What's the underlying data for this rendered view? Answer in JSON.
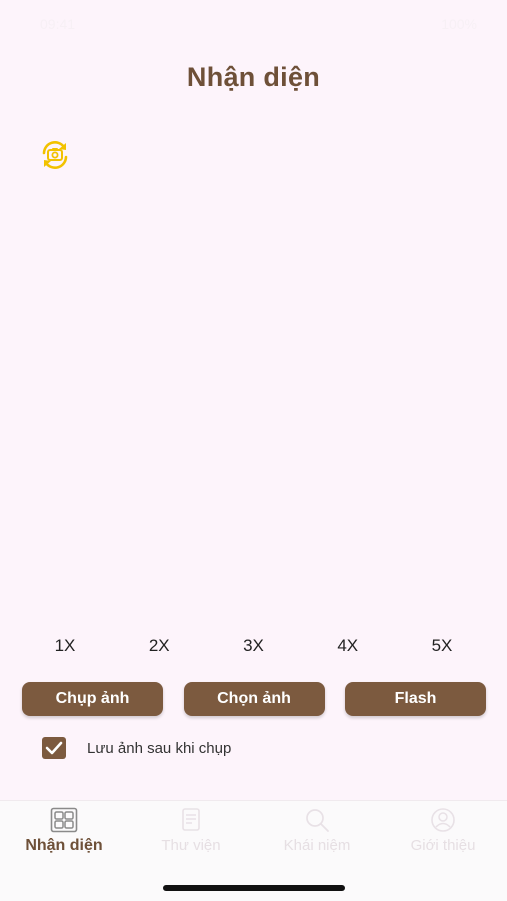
{
  "status_bar": {
    "time": "09:41",
    "battery": "100%"
  },
  "header": {
    "title": "Nhận diện"
  },
  "camera": {
    "switch_icon": "camera-switch-icon",
    "accent_color": "#f2c200"
  },
  "zoom": {
    "options": [
      "1X",
      "2X",
      "3X",
      "4X",
      "5X"
    ]
  },
  "actions": {
    "capture_label": "Chụp ảnh",
    "choose_label": "Chọn ảnh",
    "flash_label": "Flash"
  },
  "save_option": {
    "label": "Lưu ảnh sau khi chụp",
    "checked": true
  },
  "tabs": [
    {
      "label": "Nhận diện",
      "icon": "grid-icon",
      "active": true
    },
    {
      "label": "Thư viện",
      "icon": "library-icon",
      "active": false
    },
    {
      "label": "Khái niệm",
      "icon": "search-icon",
      "active": false
    },
    {
      "label": "Giới thiệu",
      "icon": "profile-icon",
      "active": false
    }
  ],
  "colors": {
    "primary": "#7c5a3f",
    "title": "#6e5038",
    "background": "#fdf4fb"
  }
}
